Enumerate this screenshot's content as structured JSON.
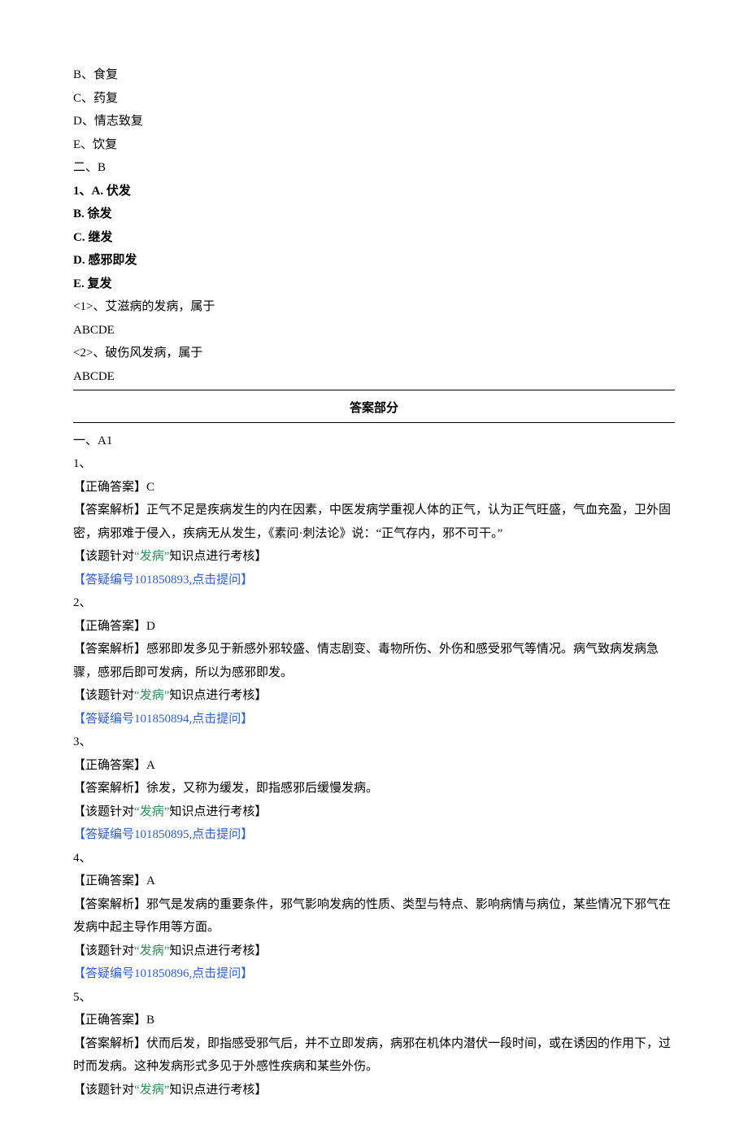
{
  "options_top": {
    "B": "B、食复",
    "C": "C、药复",
    "D": "D、情志致复",
    "E": "E、饮复"
  },
  "sectionB_header": "二、B",
  "q1": {
    "stem": "1、A. 伏发",
    "B": "B. 徐发",
    "C": "C. 继发",
    "D": "D. 感邪即发",
    "E": "E. 复发",
    "sub1": "<1>、艾滋病的发病，属于",
    "sub1_choices": "ABCDE",
    "sub2": "<2>、破伤风发病，属于",
    "sub2_choices": "ABCDE"
  },
  "answer_section_title": "答案部分",
  "sectionA_header": "一、A1",
  "labels": {
    "correct_prefix": "【正确答案】",
    "analysis_prefix": "【答案解析】",
    "topic_prefix": "【该题针对",
    "topic_quote_open": "“",
    "topic_word": "发病",
    "topic_quote_close": "”",
    "topic_suffix": "知识点进行考核】",
    "faq_open": "【答疑编号",
    "faq_action": ",点击提问】"
  },
  "answers": {
    "a1": {
      "num": "1、",
      "correct": "C",
      "analysis": "正气不足是疾病发生的内在因素，中医发病学重视人体的正气，认为正气旺盛，气血充盈，卫外固密，病邪难于侵入，疾病无从发生，《素问·刺法论》说：“正气存内，邪不可干。”",
      "faq_id": "101850893"
    },
    "a2": {
      "num": "2、",
      "correct": "D",
      "analysis": "感邪即发多见于新感外邪较盛、情志剧变、毒物所伤、外伤和感受邪气等情况。病气致病发病急骤，感邪后即可发病，所以为感邪即发。",
      "faq_id": "101850894"
    },
    "a3": {
      "num": "3、",
      "correct": "A",
      "analysis": "徐发，又称为缓发，即指感邪后缓慢发病。",
      "faq_id": "101850895"
    },
    "a4": {
      "num": "4、",
      "correct": "A",
      "analysis": "邪气是发病的重要条件，邪气影响发病的性质、类型与特点、影响病情与病位，某些情况下邪气在发病中起主导作用等方面。",
      "faq_id": "101850896"
    },
    "a5": {
      "num": "5、",
      "correct": "B",
      "analysis": "伏而后发，即指感受邪气后，并不立即发病，病邪在机体内潜伏一段时间，或在诱因的作用下，过时而发病。这种发病形式多见于外感性疾病和某些外伤。"
    }
  }
}
